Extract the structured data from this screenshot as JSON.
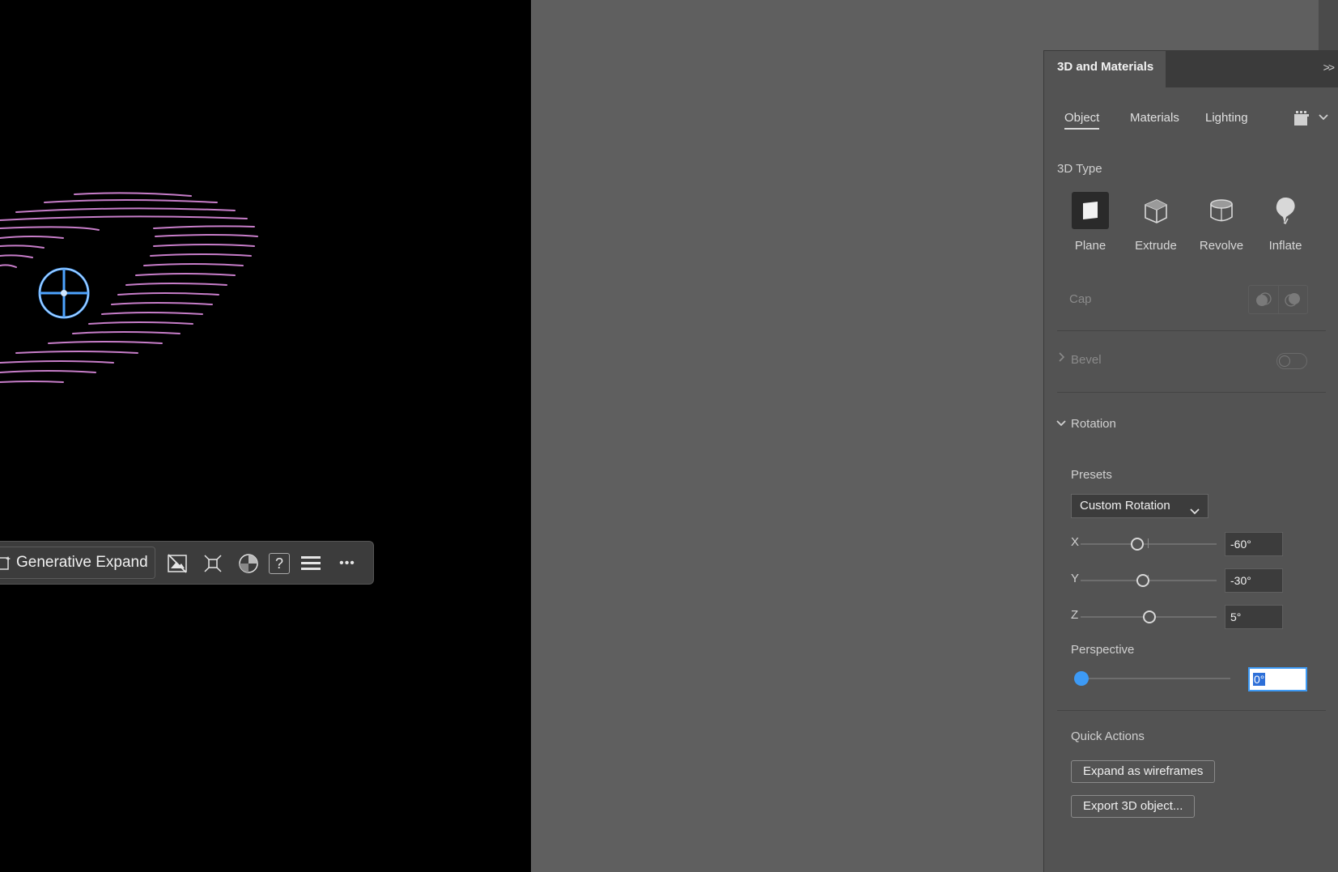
{
  "panel": {
    "title": "3D and Materials",
    "collapse_glyph": ">>",
    "tabs": [
      "Object",
      "Materials",
      "Lighting"
    ],
    "active_tab": "Object",
    "type_section_label": "3D Type",
    "types": [
      {
        "label": "Plane",
        "icon": "plane-icon",
        "selected": true
      },
      {
        "label": "Extrude",
        "icon": "extrude-icon",
        "selected": false
      },
      {
        "label": "Revolve",
        "icon": "revolve-icon",
        "selected": false
      },
      {
        "label": "Inflate",
        "icon": "inflate-icon",
        "selected": false
      }
    ],
    "cap_label": "Cap",
    "bevel_label": "Bevel",
    "bevel_enabled": false,
    "rotation_label": "Rotation",
    "presets_label": "Presets",
    "preset_value": "Custom Rotation",
    "axes": [
      {
        "label": "X",
        "value": "-60°",
        "degrees": -60
      },
      {
        "label": "Y",
        "value": "-30°",
        "degrees": -30
      },
      {
        "label": "Z",
        "value": "5°",
        "degrees": 5
      }
    ],
    "perspective_label": "Perspective",
    "perspective_value": "0°",
    "quick_actions_label": "Quick Actions",
    "quick_actions": [
      "Expand as wireframes",
      "Export 3D object..."
    ]
  },
  "taskbar": {
    "generative_expand_label": "Generative Expand",
    "icons": [
      "hide-image-icon",
      "crop-fit-icon",
      "recolor-icon",
      "help-icon",
      "menu-icon",
      "more-icon"
    ],
    "help_glyph": "?",
    "more_glyph": "•••"
  },
  "colors": {
    "artwork_stroke": "#c77dc9",
    "target_ring": "#4da3ff",
    "accent": "#3d9af5",
    "panel_bg": "#535353",
    "canvas_bg": "#000000"
  }
}
